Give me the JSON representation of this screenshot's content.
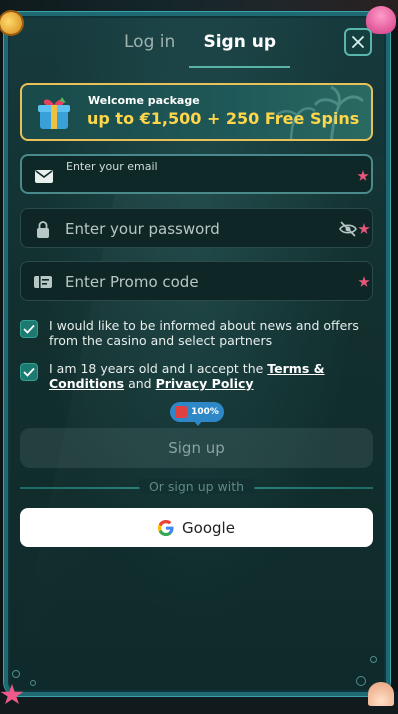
{
  "tabs": [
    {
      "label": "Log in",
      "active": false
    },
    {
      "label": "Sign up",
      "active": true
    }
  ],
  "close": {
    "icon": "close-icon"
  },
  "banner": {
    "subtitle": "Welcome package",
    "title": "up to €1,500 + 250 Free Spins",
    "icon": "gift-icon"
  },
  "fields": {
    "email": {
      "label": "Enter your email",
      "value": "",
      "icon": "envelope-icon"
    },
    "password": {
      "placeholder": "Enter your password",
      "icon": "lock-icon",
      "toggle_icon": "eye-off-icon"
    },
    "promo": {
      "placeholder": "Enter Promo code",
      "icon": "ticket-icon"
    }
  },
  "checkboxes": [
    {
      "checked": true,
      "text": "I would like to be informed about news and offers from the casino and select partners"
    },
    {
      "checked": true,
      "text_before": "I am 18 years old and I accept the ",
      "link1": "Terms & Conditions",
      "text_mid": " and ",
      "link2": "Privacy Policy"
    }
  ],
  "bonus_pill": {
    "label": "100%"
  },
  "signup_button": {
    "label": "Sign up"
  },
  "divider_label": "Or sign up with",
  "google_button": {
    "label": "Google",
    "icon": "google-icon"
  },
  "colors": {
    "accent": "#59b3a9",
    "banner_text": "#ffd64a",
    "check": "#1d7a70",
    "pill": "#2e88c8"
  }
}
